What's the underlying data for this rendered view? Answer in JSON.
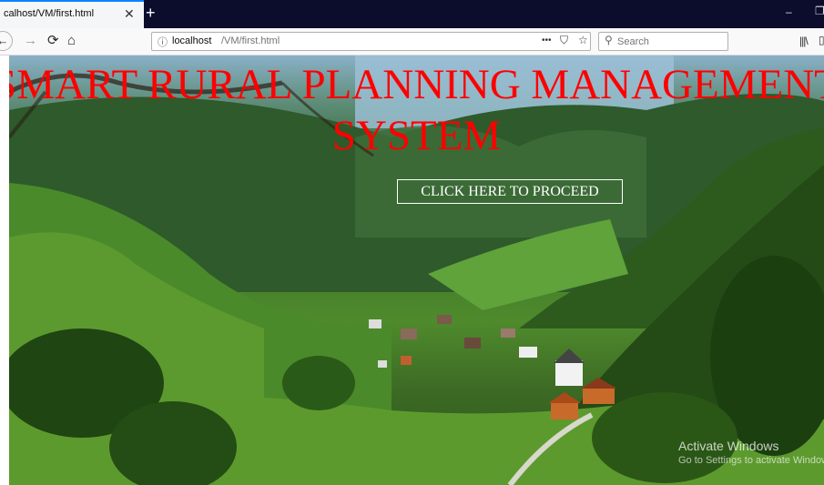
{
  "browser": {
    "tab_title": "calhost/VM/first.html",
    "tab_close": "✕",
    "new_tab": "+",
    "url_host": "localhost",
    "url_path": "/VM/first.html",
    "url_more": "•••",
    "search_placeholder": "Search",
    "minimize": "–",
    "restore": "❐"
  },
  "page": {
    "title": "SMART RURAL PLANNING MANAGEMENT SYSTEM",
    "title_line1": "SMART RURAL PLANNING MANAGEMENT",
    "title_line2": "SYSTEM",
    "proceed_label": "CLICK HERE TO PROCEED",
    "title_color": "#ff0000"
  },
  "watermark": {
    "title": "Activate Windows",
    "subtitle": "Go to Settings to activate Windows."
  }
}
